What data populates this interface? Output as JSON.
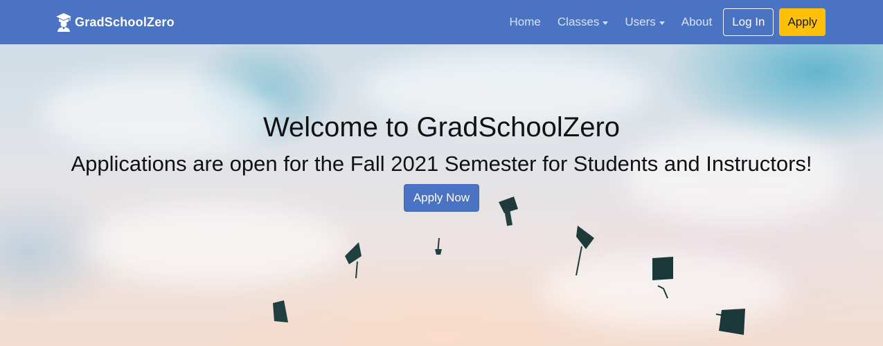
{
  "navbar": {
    "brand": {
      "name": "GradSchoolZero",
      "icon": "graduate-icon"
    },
    "links": [
      {
        "label": "Home",
        "dropdown": false
      },
      {
        "label": "Classes",
        "dropdown": true
      },
      {
        "label": "Users",
        "dropdown": true
      },
      {
        "label": "About",
        "dropdown": false
      }
    ],
    "login_label": "Log In",
    "apply_label": "Apply"
  },
  "hero": {
    "title": "Welcome to GradSchoolZero",
    "subtitle": "Applications are open for the Fall 2021 Semester for Students and Instructors!",
    "cta_label": "Apply Now"
  },
  "colors": {
    "navbar": "#4a73c4",
    "apply_button": "#ffc107",
    "cta_button": "#4a73c4"
  }
}
